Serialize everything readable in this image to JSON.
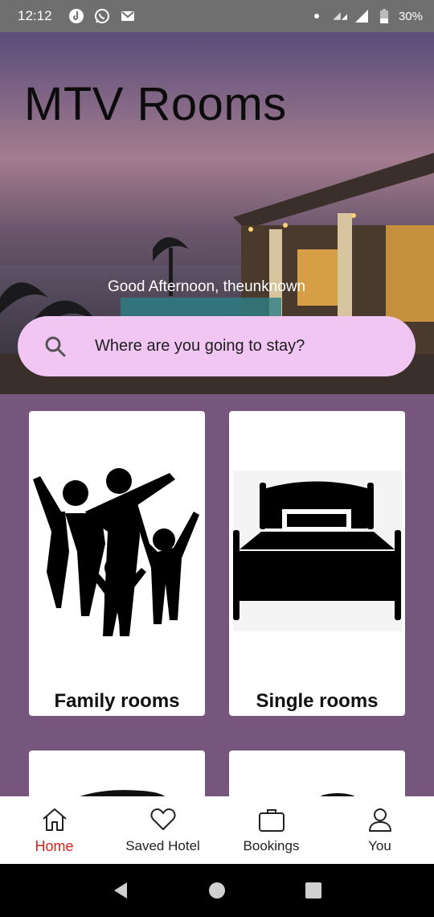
{
  "status_bar": {
    "time": "12:12",
    "battery": "30%",
    "icons": [
      "tiktok-icon",
      "whatsapp-icon",
      "gmail-icon",
      "dot-icon",
      "signal-icon",
      "wifi-icon",
      "battery-icon"
    ]
  },
  "hero": {
    "title": "MTV Rooms",
    "greeting": "Good Afternoon, theunknown"
  },
  "search": {
    "placeholder": "Where are you going to stay?"
  },
  "categories": [
    {
      "label": "Family rooms",
      "icon": "family-icon"
    },
    {
      "label": "Single rooms",
      "icon": "bed-icon"
    }
  ],
  "nav": {
    "items": [
      {
        "label": "Home",
        "icon": "home-icon",
        "active": true
      },
      {
        "label": "Saved Hotel",
        "icon": "heart-icon",
        "active": false
      },
      {
        "label": "Bookings",
        "icon": "briefcase-icon",
        "active": false
      },
      {
        "label": "You",
        "icon": "user-icon",
        "active": false
      }
    ]
  },
  "colors": {
    "status_bar": "#6f6f6f",
    "search_bg": "#f1c6f3",
    "content_bg": "#76567d",
    "active_nav": "#e0211c"
  }
}
